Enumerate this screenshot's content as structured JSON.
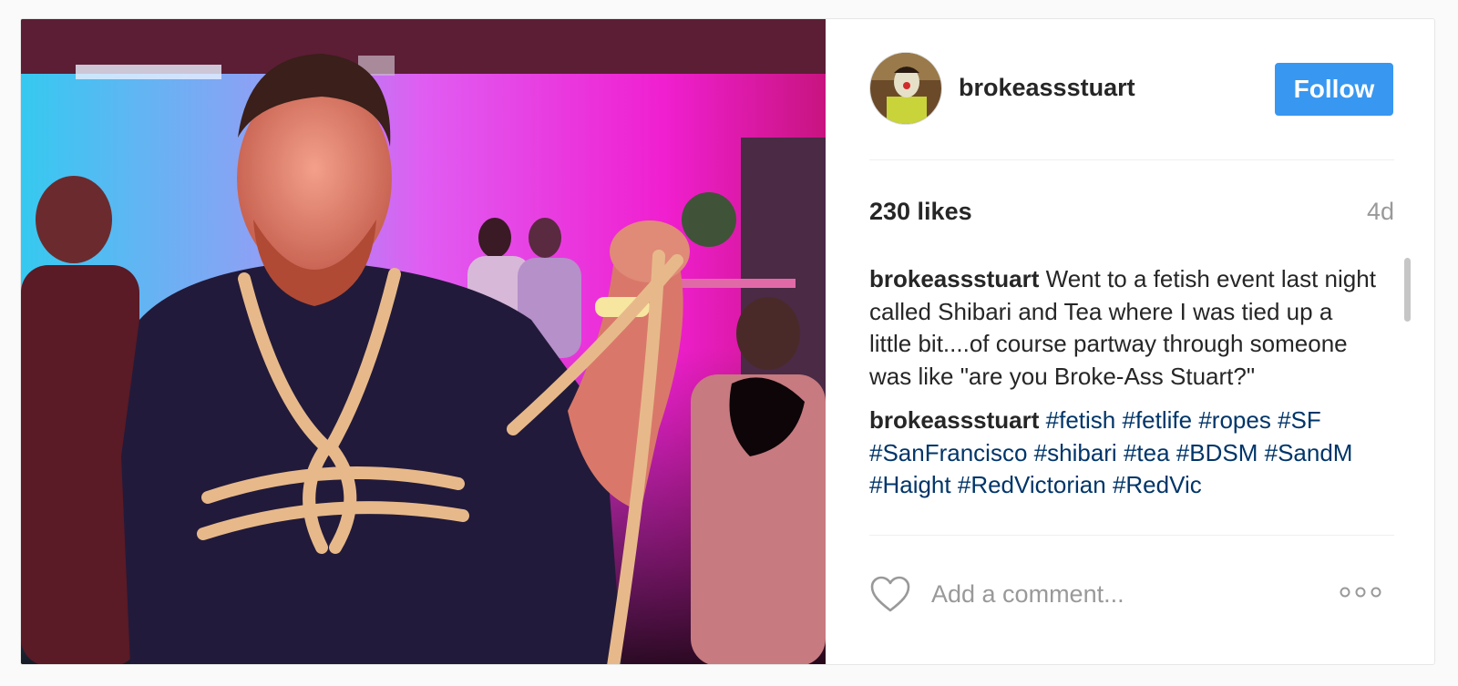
{
  "post": {
    "image_alt": "Photo of a man with ropes tied around his chest at an event",
    "header": {
      "username": "brokeassstuart",
      "follow_label": "Follow"
    },
    "stats": {
      "likes": "230 likes",
      "time": "4d"
    },
    "comments": [
      {
        "author": "brokeassstuart",
        "text": " Went to a fetish event last night called Shibari and Tea where I was tied up a little bit....of course partway through someone was like \"are you Broke-Ass Stuart?\""
      },
      {
        "author": "brokeassstuart",
        "tags": [
          "#fetish",
          "#fetlife",
          "#ropes",
          "#SF",
          "#SanFrancisco",
          "#shibari",
          "#tea",
          "#BDSM",
          "#SandM",
          "#Haight",
          "#RedVictorian",
          "#RedVic"
        ]
      }
    ],
    "actions": {
      "like_icon": "heart-outline-icon",
      "comment_placeholder": "Add a comment...",
      "more_icon": "more-options-icon"
    },
    "colors": {
      "follow_button": "#3897f0",
      "hashtag": "#003569",
      "timestamp": "#999999"
    }
  }
}
